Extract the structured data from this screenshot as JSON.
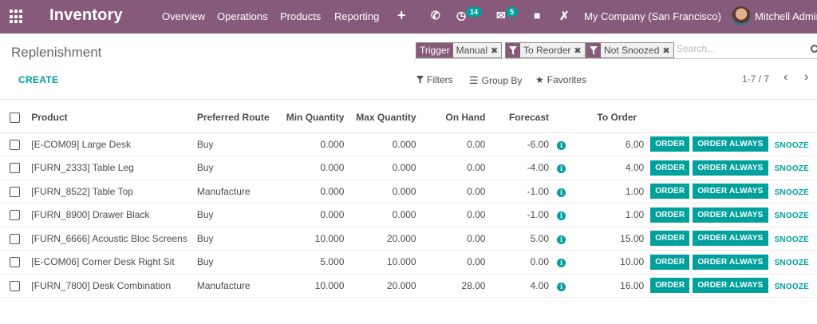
{
  "navbar": {
    "app_title": "Inventory",
    "menus": [
      "Overview",
      "Operations",
      "Products",
      "Reporting"
    ],
    "add_icon": "plus-icon",
    "activity_badge": "14",
    "messages_badge": "5",
    "company": "My Company (San Francisco)",
    "user": "Mitchell Admin"
  },
  "control": {
    "breadcrumb": "Replenishment",
    "facets": [
      {
        "tag": "Trigger",
        "value": "Manual"
      },
      {
        "tag": "filter-icon",
        "value": "To Reorder"
      },
      {
        "tag": "filter-icon",
        "value": "Not Snoozed"
      }
    ],
    "search_placeholder": "Search...",
    "create_label": "CREATE",
    "filters_label": "Filters",
    "groupby_label": "Group By",
    "favorites_label": "Favorites",
    "pager": "1-7 / 7"
  },
  "table": {
    "headers": [
      "Product",
      "Preferred Route",
      "Min Quantity",
      "Max Quantity",
      "On Hand",
      "Forecast",
      "To Order"
    ],
    "buttons": {
      "order": "ORDER",
      "order_always": "ORDER ALWAYS",
      "snooze": "SNOOZE"
    },
    "rows": [
      {
        "product": "[E-COM09] Large Desk",
        "route": "Buy",
        "min": "0.000",
        "max": "0.000",
        "on_hand": "0.00",
        "forecast": "-6.00",
        "to_order": "6.00"
      },
      {
        "product": "[FURN_2333] Table Leg",
        "route": "Buy",
        "min": "0.000",
        "max": "0.000",
        "on_hand": "0.00",
        "forecast": "-4.00",
        "to_order": "4.00"
      },
      {
        "product": "[FURN_8522] Table Top",
        "route": "Manufacture",
        "min": "0.000",
        "max": "0.000",
        "on_hand": "0.00",
        "forecast": "-1.00",
        "to_order": "1.00"
      },
      {
        "product": "[FURN_8900] Drawer Black",
        "route": "Buy",
        "min": "0.000",
        "max": "0.000",
        "on_hand": "0.00",
        "forecast": "-1.00",
        "to_order": "1.00"
      },
      {
        "product": "[FURN_6666] Acoustic Bloc Screens",
        "route": "Buy",
        "min": "10.000",
        "max": "20.000",
        "on_hand": "0.00",
        "forecast": "5.00",
        "to_order": "15.00"
      },
      {
        "product": "[E-COM06] Corner Desk Right Sit",
        "route": "Buy",
        "min": "5.000",
        "max": "10.000",
        "on_hand": "0.00",
        "forecast": "0.00",
        "to_order": "10.00"
      },
      {
        "product": "[FURN_7800] Desk Combination",
        "route": "Manufacture",
        "min": "10.000",
        "max": "20.000",
        "on_hand": "28.00",
        "forecast": "4.00",
        "to_order": "16.00"
      }
    ]
  }
}
